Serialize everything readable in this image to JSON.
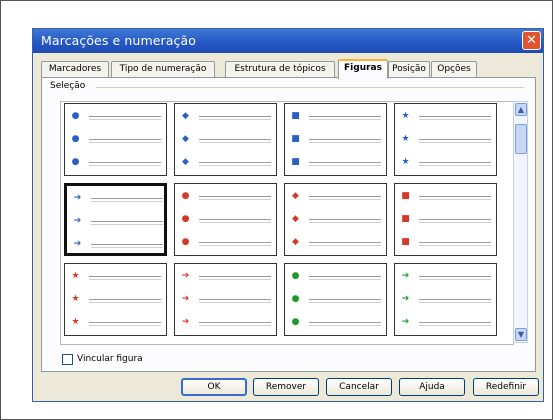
{
  "dialog": {
    "title": "Marcações e numeração",
    "close_label": "✕"
  },
  "tabs": [
    {
      "label": "Marcadores"
    },
    {
      "label": "Tipo de numeração"
    },
    {
      "label": "Estrutura de tópicos"
    },
    {
      "label": "Figuras",
      "active": true
    },
    {
      "label": "Posição"
    },
    {
      "label": "Opções"
    }
  ],
  "selection": {
    "label": "Seleção"
  },
  "bullet_cells": [
    {
      "glyph": "●",
      "color": "#2a5fc4",
      "icon": "blue-ball-icon"
    },
    {
      "glyph": "◆",
      "color": "#2a5fc4",
      "icon": "blue-arrow-icon"
    },
    {
      "glyph": "■",
      "color": "#2a5fc4",
      "icon": "blue-square-icon"
    },
    {
      "glyph": "★",
      "color": "#2a5fc4",
      "icon": "blue-star-icon"
    },
    {
      "glyph": "➔",
      "color": "#2a5fc4",
      "icon": "blue-right-arrow-icon",
      "selected": true
    },
    {
      "glyph": "●",
      "color": "#d23a2a",
      "icon": "red-ball-icon"
    },
    {
      "glyph": "◆",
      "color": "#d23a2a",
      "icon": "red-diamond-icon"
    },
    {
      "glyph": "■",
      "color": "#d23a2a",
      "icon": "red-square-icon"
    },
    {
      "glyph": "★",
      "color": "#d23a2a",
      "icon": "red-star-icon"
    },
    {
      "glyph": "➔",
      "color": "#d23a2a",
      "icon": "red-arrow-icon"
    },
    {
      "glyph": "●",
      "color": "#1e9a2c",
      "icon": "green-ball-icon"
    },
    {
      "glyph": "➔",
      "color": "#1e9a2c",
      "icon": "green-arrow-icon"
    }
  ],
  "link_figure": {
    "label": "Vincular figura",
    "checked": false
  },
  "buttons": {
    "ok": "OK",
    "remove": "Remover",
    "cancel": "Cancelar",
    "help": "Ajuda",
    "reset": "Redefinir"
  }
}
